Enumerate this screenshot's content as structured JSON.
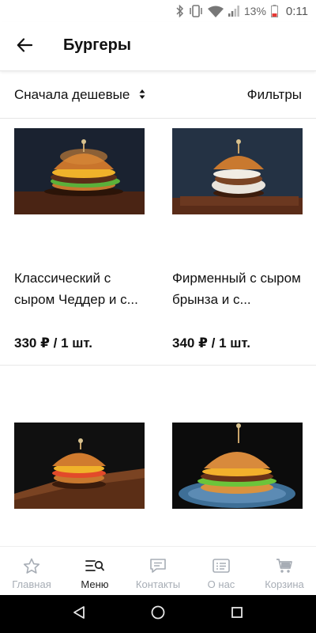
{
  "status_bar": {
    "battery_percent": "13%",
    "time": "0:11",
    "icons": [
      "bluetooth-icon",
      "vibrate-icon",
      "wifi-icon",
      "signal-icon",
      "battery-low-icon"
    ]
  },
  "header": {
    "back_icon": "arrow-left-icon",
    "title": "Бургеры"
  },
  "sort_bar": {
    "sort_label": "Сначала дешевые",
    "sort_icon": "sort-arrows-icon",
    "filters_label": "Фильтры"
  },
  "products": [
    {
      "name": "Классический с сыром Чеддер и с...",
      "price": "330 ₽ / 1 шт."
    },
    {
      "name": "Фирменный с сыром брынза и с...",
      "price": "340 ₽ / 1 шт."
    },
    {
      "name": "",
      "price": ""
    },
    {
      "name": "",
      "price": ""
    }
  ],
  "bottom_nav": {
    "items": [
      {
        "label": "Главная",
        "icon": "star-icon"
      },
      {
        "label": "Меню",
        "icon": "menu-search-icon"
      },
      {
        "label": "Контакты",
        "icon": "chat-icon"
      },
      {
        "label": "О нас",
        "icon": "info-card-icon"
      },
      {
        "label": "Корзина",
        "icon": "cart-icon"
      }
    ],
    "active_index": 1
  },
  "system_nav": {
    "icons": [
      "back-triangle-icon",
      "home-circle-icon",
      "recents-square-icon"
    ]
  },
  "colors": {
    "accent_active": "#222222",
    "nav_inactive": "#a7adb5",
    "battery_low": "#e53935",
    "system_bar": "#000000"
  }
}
